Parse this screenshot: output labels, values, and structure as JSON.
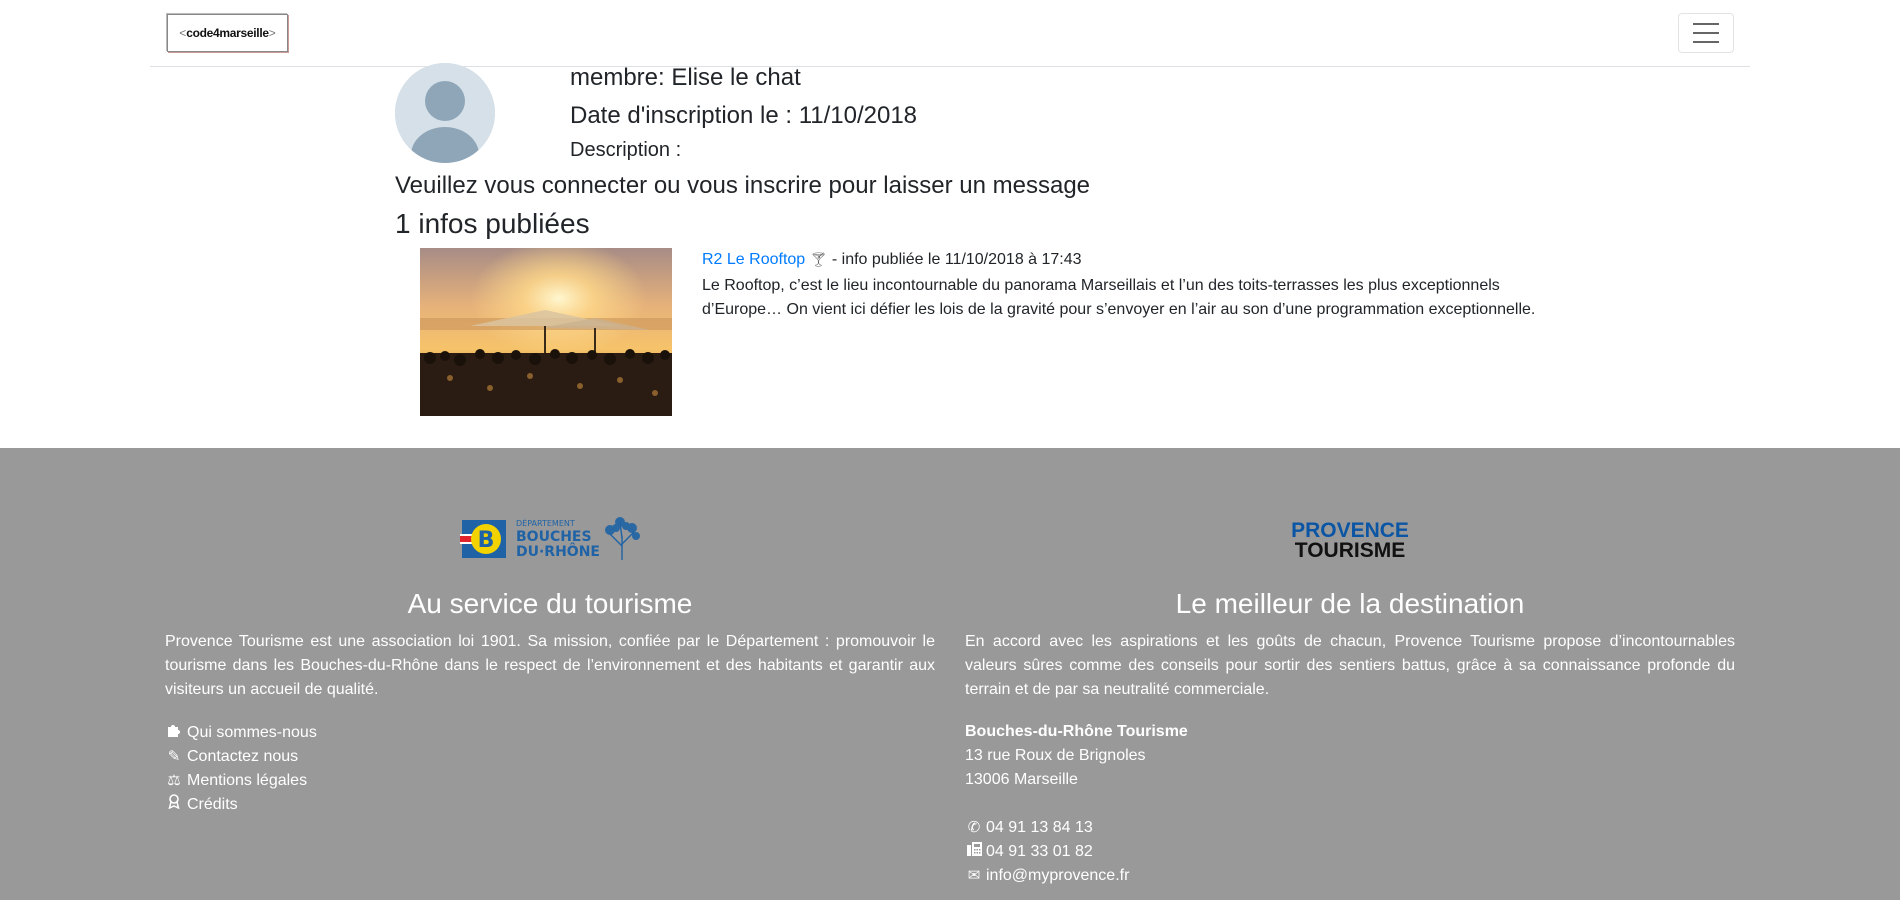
{
  "navbar": {
    "brand": {
      "open": "<",
      "text": "code4marseille",
      "close": ">"
    },
    "toggler_icon": "hamburger-icon"
  },
  "profile": {
    "avatar_icon": "user-avatar-icon",
    "member": "membre: Elise le chat",
    "date": "Date d'inscription le : 11/10/2018",
    "description_label": "Description :",
    "login_message": "Veuillez vous connecter ou vous inscrire pour laisser un message",
    "infos_count": "1 infos publiées"
  },
  "infos": [
    {
      "title": "R2 Le Rooftop",
      "title_icon": "cocktail-icon",
      "meta": " - info publiée le 11/10/2018 à 17:43",
      "body": "Le Rooftop, c’est le lieu incontournable du panorama Marseillais et l’un des toits-terrasses les plus exceptionnels d’Europe… On vient ici défier les lois de la gravité pour s’envoyer en l’air au son d’une programmation exceptionnelle."
    }
  ],
  "footer": {
    "left": {
      "logo_text_top": "DÉPARTEMENT",
      "logo_text_1": "BOUCHES",
      "logo_text_2": "DU·RHÔNE",
      "title": "Au service du tourisme",
      "text": "Provence Tourisme est une association loi 1901. Sa mission, confiée par le Département : promouvoir le tourisme dans les Bouches-du-Rhône dans le respect de l’environnement et des habitants et garantir aux visiteurs un accueil de qualité.",
      "links": [
        {
          "icon": "puzzle-icon",
          "label": "Qui sommes-nous"
        },
        {
          "icon": "pencil-icon",
          "label": "Contactez nous"
        },
        {
          "icon": "balance-scale-icon",
          "label": "Mentions légales"
        },
        {
          "icon": "award-icon",
          "label": "Crédits"
        }
      ]
    },
    "right": {
      "logo_line1": "PROVENCE",
      "logo_line2": "TOURISME",
      "title": "Le meilleur de la destination",
      "text": "En accord avec les aspirations et les goûts de chacun, Provence Tourisme propose d’incontournables valeurs sûres comme des conseils pour sortir des sentiers battus, grâce à sa connaissance profonde du terrain et de par sa neutralité commerciale.",
      "address": {
        "org": "Bouches-du-Rhône Tourisme",
        "street": "13 rue Roux de Brignoles",
        "city": "13006 Marseille"
      },
      "contacts": [
        {
          "icon": "phone-icon",
          "value": "04 91 13 84 13"
        },
        {
          "icon": "fax-icon",
          "value": "04 91 33 01 82"
        },
        {
          "icon": "envelope-icon",
          "value": "info@myprovence.fr"
        }
      ]
    }
  },
  "colors": {
    "footer_bg": "#999999",
    "link": "#007bff",
    "text": "#212529",
    "avatar_bg": "#d6e0e8",
    "avatar_fg": "#8fa6b8",
    "bdr_blue": "#1f63a6",
    "bdr_yellow": "#f2d200",
    "pt_blue": "#0b55a5"
  }
}
